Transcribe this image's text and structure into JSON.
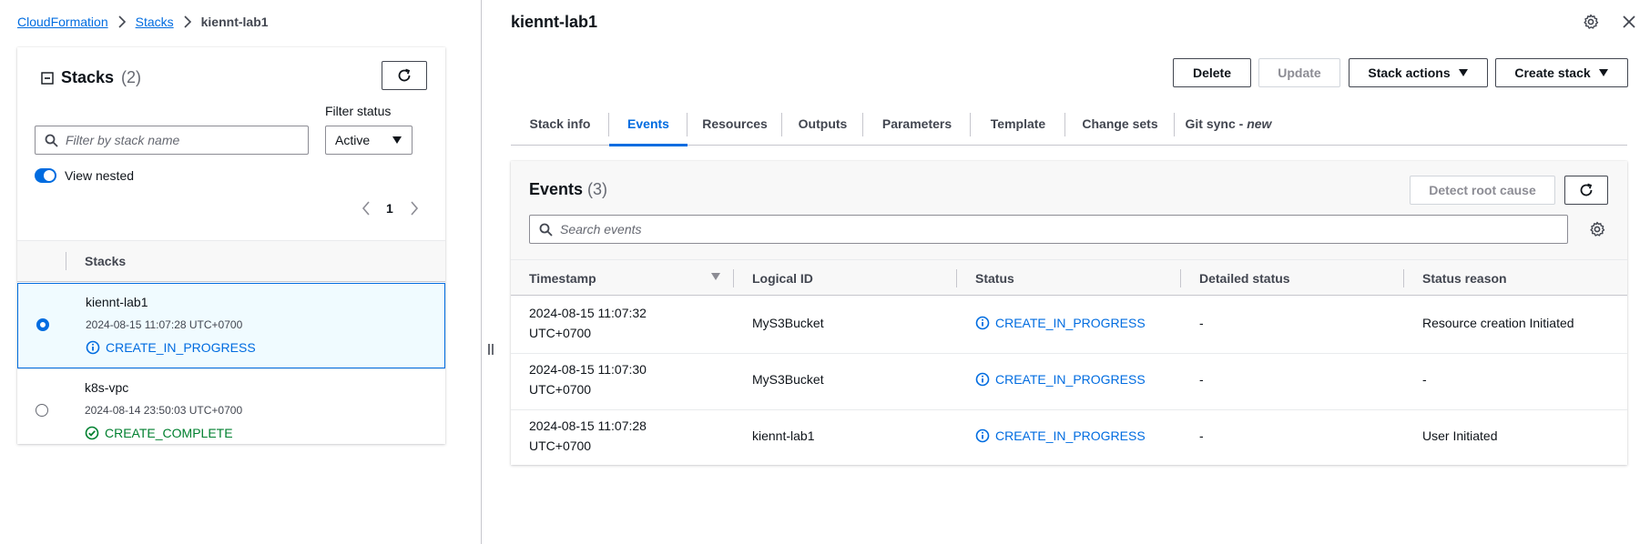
{
  "breadcrumb": {
    "root": "CloudFormation",
    "stacks": "Stacks",
    "current": "kiennt-lab1"
  },
  "stacks_panel": {
    "title": "Stacks",
    "count": "(2)",
    "filter_label": "Filter status",
    "search_placeholder": "Filter by stack name",
    "filter_value": "Active",
    "view_nested_label": "View nested",
    "page_number": "1",
    "column_header": "Stacks",
    "rows": [
      {
        "name": "kiennt-lab1",
        "date": "2024-08-15 11:07:28 UTC+0700",
        "status": "CREATE_IN_PROGRESS"
      },
      {
        "name": "k8s-vpc",
        "date": "2024-08-14 23:50:03 UTC+0700",
        "status": "CREATE_COMPLETE"
      }
    ]
  },
  "detail": {
    "title": "kiennt-lab1",
    "buttons": {
      "delete": "Delete",
      "update": "Update",
      "stack_actions": "Stack actions",
      "create_stack": "Create stack"
    },
    "tabs": [
      "Stack info",
      "Events",
      "Resources",
      "Outputs",
      "Parameters",
      "Template",
      "Change sets",
      "Git sync - "
    ],
    "tab_new": "new",
    "events": {
      "title": "Events",
      "count": "(3)",
      "detect_root_cause": "Detect root cause",
      "search_placeholder": "Search events",
      "columns": [
        "Timestamp",
        "Logical ID",
        "Status",
        "Detailed status",
        "Status reason"
      ],
      "rows": [
        {
          "ts1": "2024-08-15 11:07:32",
          "ts2": "UTC+0700",
          "logical_id": "MyS3Bucket",
          "status": "CREATE_IN_PROGRESS",
          "detailed": "-",
          "reason": "Resource creation Initiated"
        },
        {
          "ts1": "2024-08-15 11:07:30",
          "ts2": "UTC+0700",
          "logical_id": "MyS3Bucket",
          "status": "CREATE_IN_PROGRESS",
          "detailed": "-",
          "reason": "-"
        },
        {
          "ts1": "2024-08-15 11:07:28",
          "ts2": "UTC+0700",
          "logical_id": "kiennt-lab1",
          "status": "CREATE_IN_PROGRESS",
          "detailed": "-",
          "reason": "User Initiated"
        }
      ]
    }
  },
  "colors": {
    "accent": "#006ce0",
    "success": "#00802f",
    "border": "#c6c6cd"
  }
}
